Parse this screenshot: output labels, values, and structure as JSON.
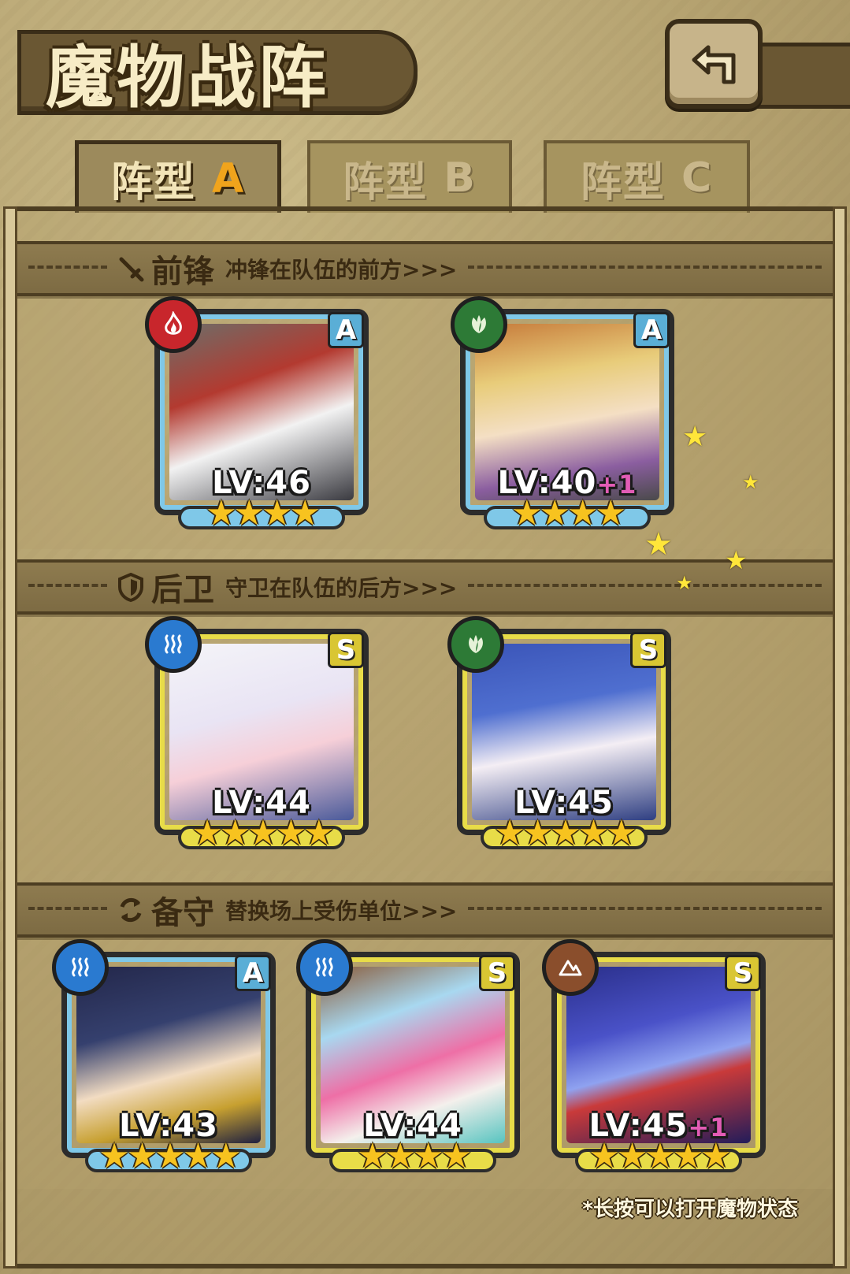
{
  "header": {
    "title": "魔物战阵",
    "back_icon": "return-arrow-icon"
  },
  "tabs": [
    {
      "label": "阵型",
      "letter": "A",
      "active": true
    },
    {
      "label": "阵型",
      "letter": "B",
      "active": false
    },
    {
      "label": "阵型",
      "letter": "C",
      "active": false
    }
  ],
  "sections": {
    "front": {
      "title": "前锋",
      "subtitle": "冲锋在队伍的前方>>>",
      "icon": "sword-icon"
    },
    "rear": {
      "title": "后卫",
      "subtitle": "守卫在队伍的后方>>>",
      "icon": "shield-icon"
    },
    "reserve": {
      "title": "备守",
      "subtitle": "替换场上受伤单位>>>",
      "icon": "swap-arrows-icon"
    }
  },
  "colors": {
    "rank_A_frame": "#7fc8e8",
    "rank_S_frame": "#e8dc48",
    "star": "#f7c31f",
    "fire": "#c8262c",
    "wood": "#2d7a36",
    "water": "#2a7ad0",
    "earth": "#8a4e2c"
  },
  "cards": {
    "front_1": {
      "level": "LV:46",
      "plus": "",
      "rank": "A",
      "element": "fire",
      "stars": "★★★★",
      "star_count": 4
    },
    "front_2": {
      "level": "LV:40",
      "plus": "+1",
      "rank": "A",
      "element": "wood",
      "stars": "★★★★",
      "star_count": 4
    },
    "rear_1": {
      "level": "LV:44",
      "plus": "",
      "rank": "S",
      "element": "water",
      "stars": "★★★★★",
      "star_count": 5
    },
    "rear_2": {
      "level": "LV:45",
      "plus": "",
      "rank": "S",
      "element": "wood",
      "stars": "★★★★★",
      "star_count": 5
    },
    "reserve_1": {
      "level": "LV:43",
      "plus": "",
      "rank": "A",
      "element": "water",
      "stars": "★★★★★",
      "star_count": 5
    },
    "reserve_2": {
      "level": "LV:44",
      "plus": "",
      "rank": "S",
      "element": "water",
      "stars": "★★★★",
      "star_count": 4
    },
    "reserve_3": {
      "level": "LV:45",
      "plus": "+1",
      "rank": "S",
      "element": "earth",
      "stars": "★★★★★",
      "star_count": 5
    }
  },
  "footer": {
    "hint": "*长按可以打开魔物状态"
  }
}
